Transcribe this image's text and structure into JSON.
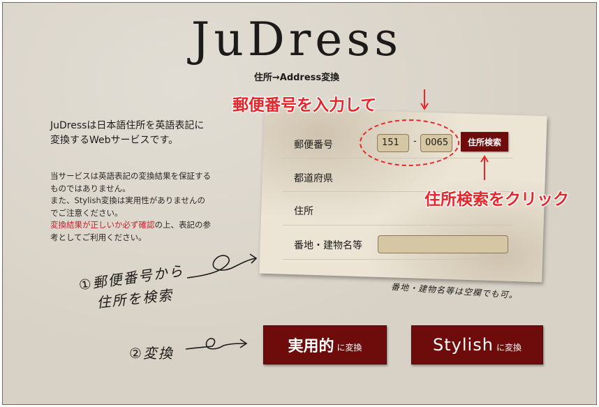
{
  "logo": "JuDress",
  "subtitle": "住所→Address変換",
  "callouts": {
    "postal": "郵便番号を入力して",
    "search": "住所検索をクリック"
  },
  "intro": {
    "line1": "JuDressは日本語住所を英語表記に",
    "line2": "変換するWebサービスです。"
  },
  "notes": {
    "line1": "当サービスは英語表記の変換結果を保証する",
    "line2": "ものではありません。",
    "line3": "また、Stylish変換は実用性がありませんの",
    "line4": "でご注意ください。",
    "line5_red": "変換結果が正しいか必ず確認",
    "line5_rest": "の上、表記の参",
    "line6": "考としてご利用ください。"
  },
  "form": {
    "postal_label": "郵便番号",
    "postal_part1": "151",
    "postal_separator": "-",
    "postal_part2": "0065",
    "search_button": "住所検索",
    "prefecture_label": "都道府県",
    "address_label": "住所",
    "block_label": "番地・建物名等",
    "block_value": ""
  },
  "handwritten": {
    "step1_line1": "①郵便番号から",
    "step1_line2": "住所を検索",
    "step2": "②変換",
    "note": "番地・建物名等は空欄でも可。"
  },
  "buttons": {
    "practical_main": "実用的",
    "practical_suffix": "に変換",
    "stylish_main": "Stylish",
    "stylish_suffix": "に変換"
  },
  "colors": {
    "accent_red": "#e8262a",
    "button_maroon": "#6e0b0b",
    "background": "#d8d2c6"
  }
}
